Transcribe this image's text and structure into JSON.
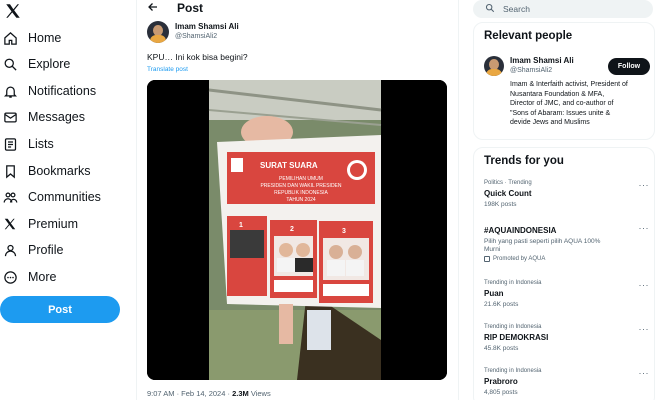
{
  "nav": {
    "items": [
      {
        "label": "Home",
        "icon": "home-icon"
      },
      {
        "label": "Explore",
        "icon": "search-icon"
      },
      {
        "label": "Notifications",
        "icon": "bell-icon"
      },
      {
        "label": "Messages",
        "icon": "mail-icon"
      },
      {
        "label": "Lists",
        "icon": "list-icon"
      },
      {
        "label": "Bookmarks",
        "icon": "bookmark-icon"
      },
      {
        "label": "Communities",
        "icon": "people-icon"
      },
      {
        "label": "Premium",
        "icon": "x-logo-icon"
      },
      {
        "label": "Profile",
        "icon": "person-icon"
      },
      {
        "label": "More",
        "icon": "more-circle-icon"
      }
    ],
    "post_button": "Post"
  },
  "post": {
    "header_title": "Post",
    "author_name": "Imam Shamsi Ali",
    "author_handle": "@ShamsiAli2",
    "text": "KPU… Ini kok bisa begini?",
    "translate": "Translate post",
    "time": "9:07 AM · Feb 14, 2024 · ",
    "views": "2.3M",
    "views_label": " Views"
  },
  "ballot": {
    "title": "SURAT SUARA",
    "line1": "PEMILIHAN UMUM",
    "line2": "PRESIDEN DAN WAKIL PRESIDEN",
    "line3": "REPUBLIK INDONESIA",
    "line4": "TAHUN 2024",
    "numbers": [
      "1",
      "2",
      "3"
    ]
  },
  "search": {
    "placeholder": "Search"
  },
  "relevant": {
    "title": "Relevant people",
    "name": "Imam Shamsi Ali",
    "handle": "@ShamsiAli2",
    "follow": "Follow",
    "bio_lines": [
      "Imam & Interfaith activist, President of",
      "Nusantara Foundation & MFA,",
      "Director of JMC, and co-author of",
      "\"Sons of Abaram: Issues unite &",
      "devide Jews and Muslims"
    ]
  },
  "trends": {
    "title": "Trends for you",
    "items": [
      {
        "context": "Politics · Trending",
        "name": "Quick Count",
        "sub": "198K posts"
      },
      {
        "context": "",
        "name": "#AQUAINDONESIA",
        "sub": "Pilih yang pasti seperti pilih AQUA 100%",
        "sub2": "Murni",
        "promo": "Promoted by AQUA"
      },
      {
        "context": "Trending in Indonesia",
        "name": "Puan",
        "sub": "21.6K posts"
      },
      {
        "context": "Trending in Indonesia",
        "name": "RIP DEMOKRASI",
        "sub": "45.8K posts"
      },
      {
        "context": "Trending in Indonesia",
        "name": "Prabroro",
        "sub": "4,805 posts"
      }
    ],
    "more": "···"
  },
  "colors": {
    "accent": "#1d9bf0",
    "text": "#0f1419",
    "muted": "#536471",
    "ballot_red": "#d9463f"
  }
}
